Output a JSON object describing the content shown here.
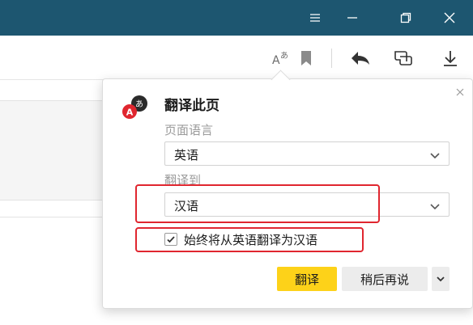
{
  "window_controls": {
    "menu_icon": "menu-icon",
    "minimize_icon": "minimize-icon",
    "restore_icon": "restore-icon",
    "close_icon": "close-icon"
  },
  "toolbar": {
    "icons": [
      "translate-icon",
      "bookmark-icon",
      "back-icon",
      "screenshot-icon",
      "download-icon"
    ]
  },
  "popup": {
    "title": "翻译此页",
    "source_label": "页面语言",
    "source_value": "英语",
    "target_label": "翻译到",
    "target_value": "汉语",
    "always_translate_label": "始终将从英语翻译为汉语",
    "always_translate_checked": true,
    "translate_button": "翻译",
    "later_button": "稍后再说",
    "logo_letter": "A",
    "logo_glyph": "あ"
  },
  "colors": {
    "titlebar": "#1d5670",
    "accent_button": "#fdd219",
    "highlight_box": "#e0262f",
    "logo_red": "#e0262f",
    "logo_dark": "#2b2b2b"
  }
}
